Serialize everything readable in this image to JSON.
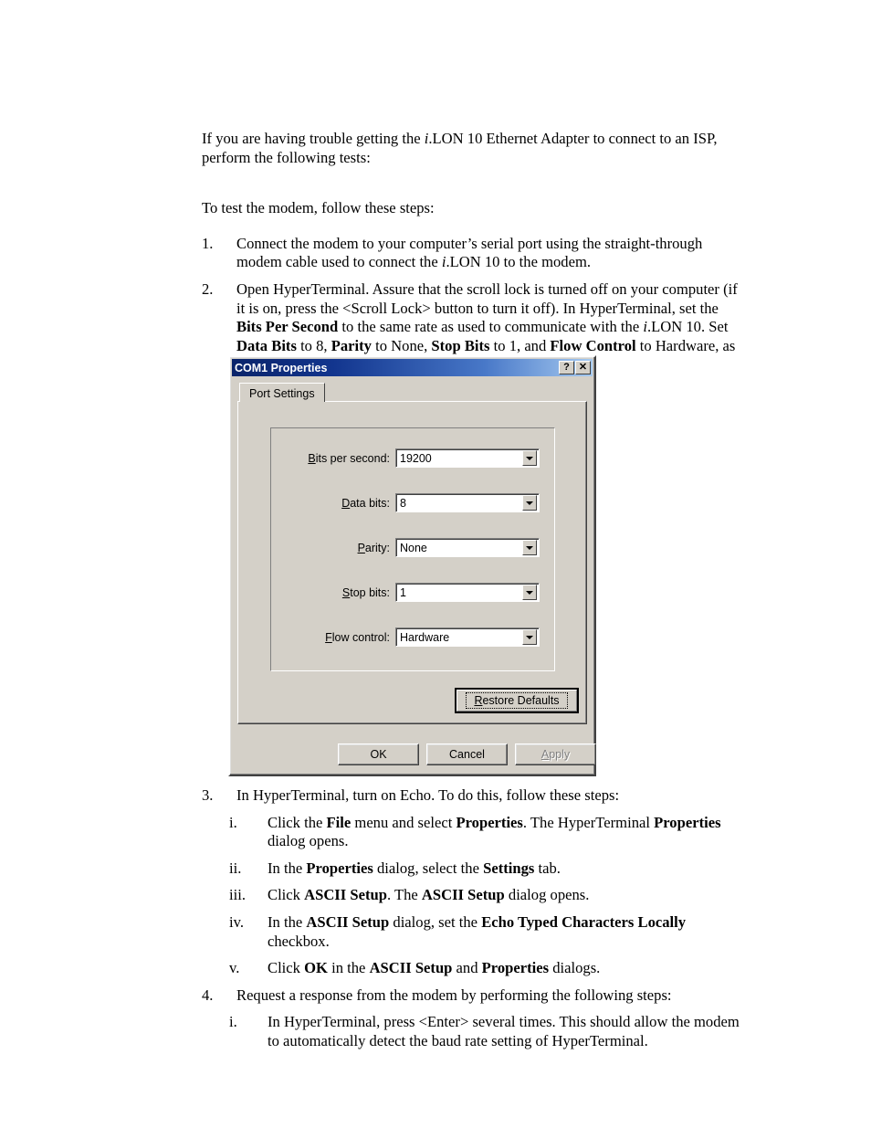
{
  "document": {
    "intro": {
      "text_before_italic": "If you are having trouble getting the ",
      "italic": "i",
      "text_after_italic": ".LON 10 Ethernet Adapter to connect to an ISP, perform the following tests:"
    },
    "lead_in": "To test the modem, follow these steps:",
    "steps": [
      {
        "marker": "1.",
        "seg": [
          {
            "t": "Connect the modem to your computer’s serial port using the straight-through modem cable used to connect the ",
            "s": "n"
          },
          {
            "t": "i",
            "s": "i"
          },
          {
            "t": ".LON 10 to the modem.",
            "s": "n"
          }
        ]
      },
      {
        "marker": "2.",
        "seg": [
          {
            "t": "Open HyperTerminal.  Assure that the scroll lock is turned off on your computer (if it is on, press the <Scroll Lock> button to turn it off).  In HyperTerminal, set the ",
            "s": "n"
          },
          {
            "t": "Bits Per Second",
            "s": "b"
          },
          {
            "t": " to the same rate as used to communicate with the ",
            "s": "n"
          },
          {
            "t": "i",
            "s": "i"
          },
          {
            "t": ".LON 10.  Set ",
            "s": "n"
          },
          {
            "t": "Data Bits",
            "s": "b"
          },
          {
            "t": " to 8, ",
            "s": "n"
          },
          {
            "t": "Parity",
            "s": "b"
          },
          {
            "t": " to None, ",
            "s": "n"
          },
          {
            "t": "Stop Bits",
            "s": "b"
          },
          {
            "t": " to 1, and ",
            "s": "n"
          },
          {
            "t": "Flow Control",
            "s": "b"
          },
          {
            "t": " to Hardware, as shown in the following figure:",
            "s": "n"
          }
        ]
      },
      {
        "marker": "3.",
        "seg": [
          {
            "t": "In HyperTerminal, turn on Echo.  To do this, follow these steps:",
            "s": "n"
          }
        ]
      },
      {
        "marker": "4.",
        "seg": [
          {
            "t": "Request a response from the modem by performing the following steps:",
            "s": "n"
          }
        ]
      }
    ],
    "substeps_3": [
      {
        "marker": "i.",
        "seg": [
          {
            "t": "Click the ",
            "s": "n"
          },
          {
            "t": "File",
            "s": "b"
          },
          {
            "t": " menu and select ",
            "s": "n"
          },
          {
            "t": "Properties",
            "s": "b"
          },
          {
            "t": ".  The HyperTerminal ",
            "s": "n"
          },
          {
            "t": "Properties",
            "s": "b"
          },
          {
            "t": " dialog opens.",
            "s": "n"
          }
        ]
      },
      {
        "marker": "ii.",
        "seg": [
          {
            "t": "In the ",
            "s": "n"
          },
          {
            "t": "Properties",
            "s": "b"
          },
          {
            "t": " dialog, select the ",
            "s": "n"
          },
          {
            "t": "Settings",
            "s": "b"
          },
          {
            "t": " tab.",
            "s": "n"
          }
        ]
      },
      {
        "marker": "iii.",
        "seg": [
          {
            "t": "Click ",
            "s": "n"
          },
          {
            "t": "ASCII Setup",
            "s": "b"
          },
          {
            "t": ".  The ",
            "s": "n"
          },
          {
            "t": "ASCII Setup",
            "s": "b"
          },
          {
            "t": " dialog opens.",
            "s": "n"
          }
        ]
      },
      {
        "marker": "iv.",
        "seg": [
          {
            "t": "In the ",
            "s": "n"
          },
          {
            "t": "ASCII Setup",
            "s": "b"
          },
          {
            "t": " dialog, set the ",
            "s": "n"
          },
          {
            "t": "Echo Typed Characters Locally",
            "s": "b"
          },
          {
            "t": " checkbox.",
            "s": "n"
          }
        ]
      },
      {
        "marker": "v.",
        "seg": [
          {
            "t": "Click ",
            "s": "n"
          },
          {
            "t": "OK",
            "s": "b"
          },
          {
            "t": " in the ",
            "s": "n"
          },
          {
            "t": "ASCII Setup",
            "s": "b"
          },
          {
            "t": " and ",
            "s": "n"
          },
          {
            "t": "Properties",
            "s": "b"
          },
          {
            "t": " dialogs.",
            "s": "n"
          }
        ]
      }
    ],
    "substeps_4": [
      {
        "marker": "i.",
        "seg": [
          {
            "t": "In HyperTerminal, press <Enter> several times.  This should allow the modem to automatically detect the baud rate setting of HyperTerminal.",
            "s": "n"
          }
        ]
      }
    ]
  },
  "dialog": {
    "title": "COM1 Properties",
    "titlebar_buttons": [
      {
        "name": "help-button",
        "glyph": "?"
      },
      {
        "name": "close-button",
        "glyph": "✕"
      }
    ],
    "tabs": [
      {
        "label": "Port Settings",
        "selected": true
      }
    ],
    "fields": [
      {
        "label_accel": "B",
        "label_rest": "its per second:",
        "value": "19200"
      },
      {
        "label_accel": "D",
        "label_rest": "ata bits:",
        "value": "8"
      },
      {
        "label_accel": "P",
        "label_rest": "arity:",
        "value": "None"
      },
      {
        "label_accel": "S",
        "label_rest": "top bits:",
        "value": "1"
      },
      {
        "label_accel": "F",
        "label_rest": "low control:",
        "value": "Hardware"
      }
    ],
    "restore_button": {
      "accel": "R",
      "rest": "estore Defaults",
      "focused": true
    },
    "buttons": [
      {
        "label": "OK",
        "enabled": true
      },
      {
        "label": "Cancel",
        "enabled": true
      },
      {
        "label": "Apply",
        "enabled": false,
        "accel": "A",
        "rest": "pply"
      }
    ],
    "colors": {
      "face": "#d4d0c8",
      "titlebar_start": "#0a246a",
      "titlebar_end": "#a6caf0",
      "disabled_text": "#808080"
    }
  }
}
